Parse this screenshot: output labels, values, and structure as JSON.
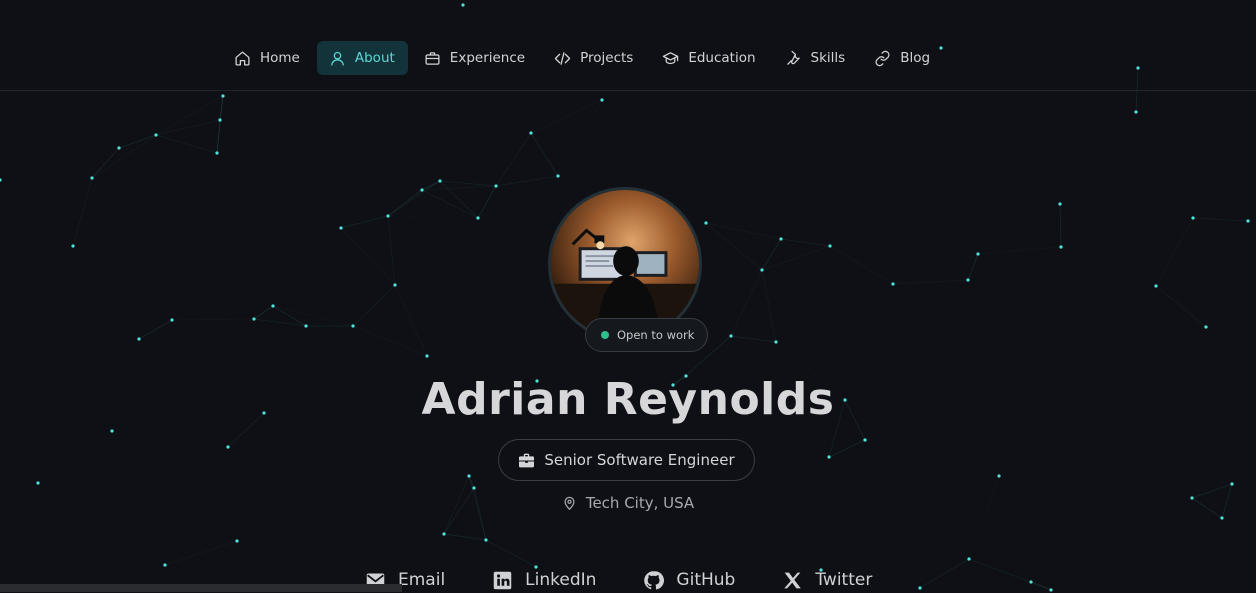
{
  "nav": {
    "items": [
      {
        "label": "Home",
        "icon": "home-icon",
        "active": false
      },
      {
        "label": "About",
        "icon": "user-icon",
        "active": true
      },
      {
        "label": "Experience",
        "icon": "briefcase-icon",
        "active": false
      },
      {
        "label": "Projects",
        "icon": "code-icon",
        "active": false
      },
      {
        "label": "Education",
        "icon": "graduation-cap-icon",
        "active": false
      },
      {
        "label": "Skills",
        "icon": "wrench-icon",
        "active": false
      },
      {
        "label": "Blog",
        "icon": "link-icon",
        "active": false
      }
    ]
  },
  "profile": {
    "status": "Open to work",
    "name": "Adrian Reynolds",
    "role": "Senior Software Engineer",
    "location": "Tech City, USA"
  },
  "social": [
    {
      "label": "Email",
      "icon": "mail-icon"
    },
    {
      "label": "LinkedIn",
      "icon": "linkedin-icon"
    },
    {
      "label": "GitHub",
      "icon": "github-icon"
    },
    {
      "label": "Twitter",
      "icon": "x-icon"
    }
  ],
  "colors": {
    "background": "#0e1015",
    "accent": "#5ad8d6",
    "active_nav_bg": "#13333a",
    "status_green": "#2fbf8b",
    "particle": "#4fe3d9"
  }
}
